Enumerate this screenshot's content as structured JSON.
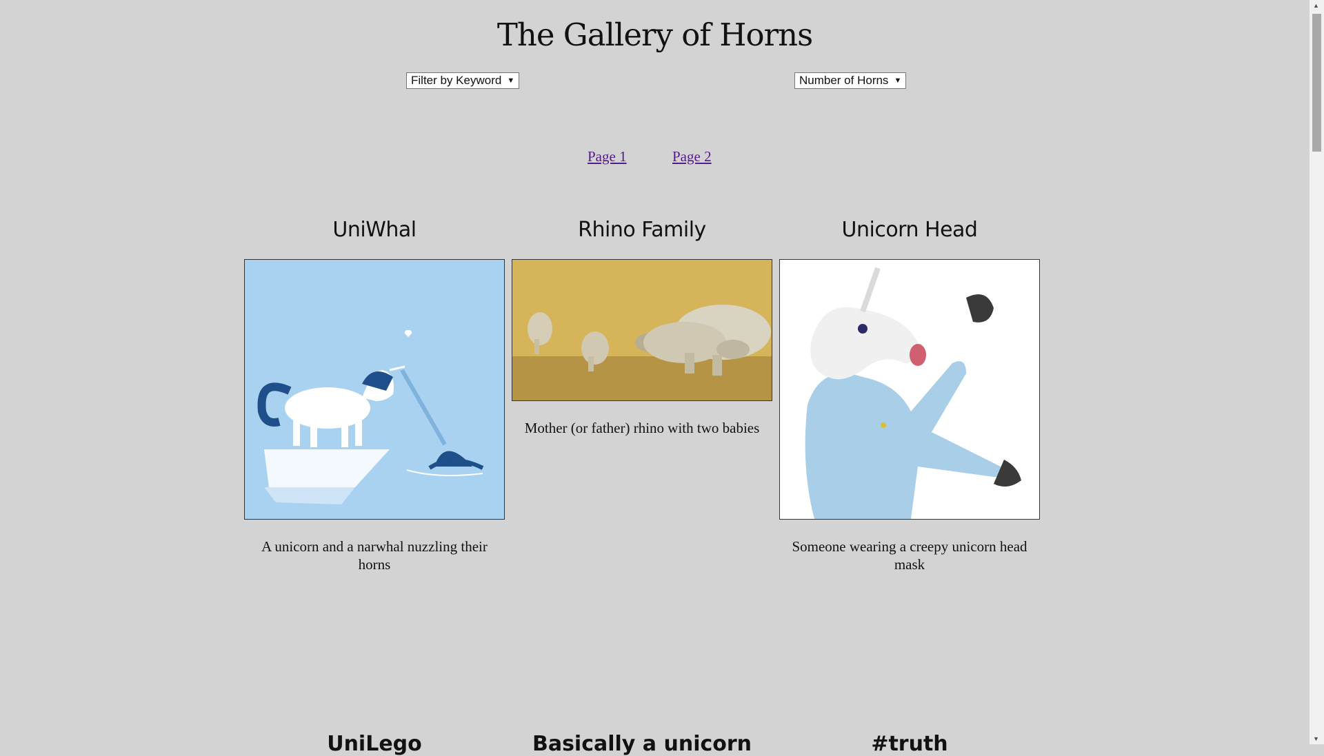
{
  "header": {
    "title": "The Gallery of Horns"
  },
  "filters": {
    "keyword_label": "Filter by Keyword",
    "horns_label": "Number of Horns",
    "arrow": "▼"
  },
  "pagination": {
    "page1": "Page 1",
    "page2": "Page 2"
  },
  "cards": [
    {
      "title": "UniWhal",
      "description": "A unicorn and a narwhal nuzzling their horns"
    },
    {
      "title": "Rhino Family",
      "description": "Mother (or father) rhino with two babies"
    },
    {
      "title": "Unicorn Head",
      "description": "Someone wearing a creepy unicorn head mask"
    }
  ],
  "next_row_titles": [
    "UniLego",
    "Basically a unicorn",
    "#truth"
  ],
  "colors": {
    "background": "#d3d3d3",
    "link_visited": "#551a8b"
  }
}
